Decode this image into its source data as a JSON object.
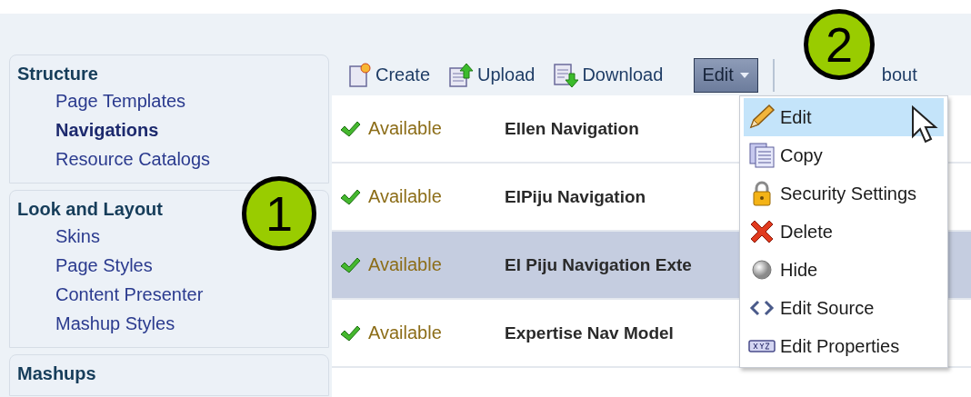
{
  "sidebar": {
    "sections": [
      {
        "title": "Structure",
        "items": [
          {
            "label": "Page Templates",
            "selected": false
          },
          {
            "label": "Navigations",
            "selected": true
          },
          {
            "label": "Resource Catalogs",
            "selected": false
          }
        ]
      },
      {
        "title": "Look and Layout",
        "items": [
          {
            "label": "Skins",
            "selected": false
          },
          {
            "label": "Page Styles",
            "selected": false
          },
          {
            "label": "Content Presenter",
            "selected": false
          },
          {
            "label": "Mashup Styles",
            "selected": false
          }
        ]
      },
      {
        "title": "Mashups"
      }
    ]
  },
  "toolbar": {
    "buttons": [
      {
        "label": "Create",
        "kind": "create"
      },
      {
        "label": "Upload",
        "kind": "upload"
      },
      {
        "label": "Download",
        "kind": "download"
      }
    ],
    "menu_button": {
      "label": "Edit",
      "expanded": true
    },
    "about": "bout"
  },
  "table": {
    "rows": [
      {
        "status": "Available",
        "name": "Ellen Navigation",
        "selected": false
      },
      {
        "status": "Available",
        "name": "ElPiju Navigation",
        "selected": false
      },
      {
        "status": "Available",
        "name": "El Piju Navigation Exte",
        "selected": true
      },
      {
        "status": "Available",
        "name": "Expertise Nav Model",
        "selected": false
      }
    ]
  },
  "menu": {
    "items": [
      {
        "label": "Edit",
        "kind": "pencil",
        "selected": true
      },
      {
        "label": "Copy",
        "kind": "copy",
        "selected": false
      },
      {
        "label": "Security Settings",
        "kind": "lock",
        "selected": false
      },
      {
        "label": "Delete",
        "kind": "delete",
        "selected": false
      },
      {
        "label": "Hide",
        "kind": "hide",
        "selected": false
      },
      {
        "label": "Edit Source",
        "kind": "source",
        "selected": false
      },
      {
        "label": "Edit Properties",
        "kind": "properties",
        "selected": false
      }
    ]
  },
  "callouts": [
    {
      "number": "1"
    },
    {
      "number": "2"
    }
  ]
}
